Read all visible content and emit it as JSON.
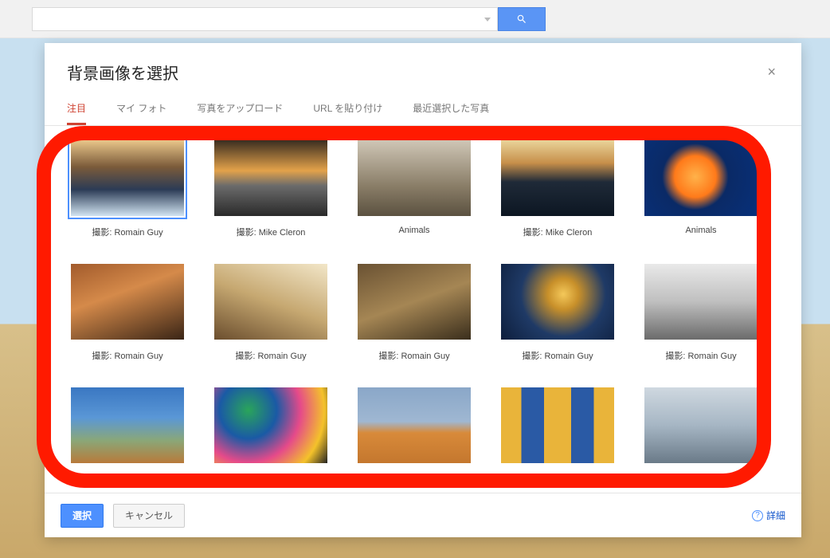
{
  "search": {
    "placeholder": ""
  },
  "dialog": {
    "title": "背景画像を選択",
    "close": "×",
    "tabs": [
      {
        "label": "注目",
        "active": true
      },
      {
        "label": "マイ フォト",
        "active": false
      },
      {
        "label": "写真をアップロード",
        "active": false
      },
      {
        "label": "URL を貼り付け",
        "active": false
      },
      {
        "label": "最近選択した写真",
        "active": false
      }
    ],
    "items": [
      {
        "label": "撮影: Romain Guy",
        "selected": true,
        "g": "g0"
      },
      {
        "label": "撮影: Mike Cleron",
        "selected": false,
        "g": "g1"
      },
      {
        "label": "Animals",
        "selected": false,
        "g": "g2"
      },
      {
        "label": "撮影: Mike Cleron",
        "selected": false,
        "g": "g3"
      },
      {
        "label": "Animals",
        "selected": false,
        "g": "g4"
      },
      {
        "label": "撮影: Romain Guy",
        "selected": false,
        "g": "g5"
      },
      {
        "label": "撮影: Romain Guy",
        "selected": false,
        "g": "g6"
      },
      {
        "label": "撮影: Romain Guy",
        "selected": false,
        "g": "g7"
      },
      {
        "label": "撮影: Romain Guy",
        "selected": false,
        "g": "g8"
      },
      {
        "label": "撮影: Romain Guy",
        "selected": false,
        "g": "g9"
      },
      {
        "label": "",
        "selected": false,
        "g": "g10"
      },
      {
        "label": "",
        "selected": false,
        "g": "g11"
      },
      {
        "label": "",
        "selected": false,
        "g": "g12"
      },
      {
        "label": "",
        "selected": false,
        "g": "g13"
      },
      {
        "label": "",
        "selected": false,
        "g": "g14"
      }
    ],
    "footer": {
      "primary": "選択",
      "secondary": "キャンセル",
      "detail": "詳細"
    }
  }
}
